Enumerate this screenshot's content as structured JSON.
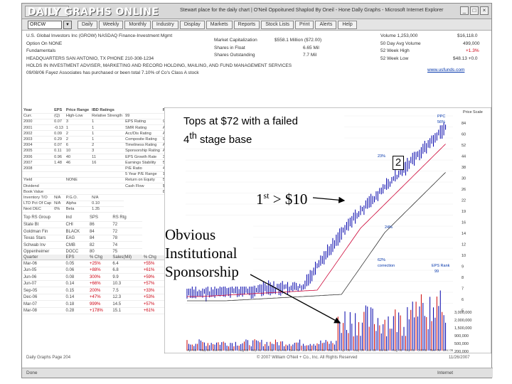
{
  "window": {
    "brand": "DAILY GRAPHS ONLINE",
    "title_bar_text": "Stewart place for the daily chart | O'Neil Oppoituned Shaplod By Oneil - Hone Dally Graphs - Microsoft Internet Explorer",
    "buttons": [
      "_",
      "□",
      "×"
    ]
  },
  "toolbar": {
    "symbol_value": "ORCW",
    "dropdown_icon": "chevron-down-icon",
    "buttons": [
      "Daily",
      "Weekly",
      "Monthly",
      "Industry",
      "Display",
      "Markets",
      "Reports",
      "Stock Lists",
      "Print",
      "Alerts",
      "Help"
    ]
  },
  "info": {
    "company_line": "U.S. Global Investors Inc (GROW) NASDAQ  Finance-Investment Mgmt",
    "option_line": "Option On   NONE",
    "fund_line": "Fundamentals",
    "hq_line": "HEADQUARTERS  SAN ANTONIO, TX        PHONE  210-308-1234",
    "desc_line_1": "HOLDS IN INVESTMENT ADVISER, MARKETING AND RECORD HOLDING, MAILING, AND FUND MANAGEMENT SERVICES",
    "desc_line_2": "09/08/06  Fayez Associates has purchased or been total 7.10% of Co's Class A stock",
    "mid_labels": [
      "Market Capitalization",
      "Shares in Float",
      "Shares Outstanding"
    ],
    "mid_values": [
      "$558.1 Million ($72.00)",
      "6.65 Mil",
      "7.7 Mil"
    ],
    "right_labels": [
      "Volume 1,253,000",
      "50 Day Avg Volume",
      "52 Week High",
      "52 Week Low"
    ],
    "right_values": [
      "$16,118.0",
      "499,000",
      "+1.3%",
      "$48.13 +0.0"
    ],
    "url_text": "www.usfunds.com"
  },
  "history": {
    "header": [
      "Year",
      "EPS",
      "Price Range",
      "IBD Ratings",
      "",
      "PERS"
    ],
    "sub_header": [
      "Curr.",
      "(Q)",
      "High-Low",
      "Relative Strength",
      "99"
    ],
    "rows": [
      [
        "2000",
        "0.07",
        "3",
        "1",
        "EPS Rating",
        "99"
      ],
      [
        "2001",
        "-0.13",
        "1",
        "1",
        "SMR Rating",
        "A"
      ],
      [
        "2002",
        "0.09",
        "2",
        "1",
        "Acc/Dis Rating",
        "A"
      ],
      [
        "2003",
        "0.29",
        "2",
        "1",
        "Composite Rating",
        "99"
      ],
      [
        "2004",
        "0.07",
        "6",
        "2",
        "Timeliness Rating",
        "A"
      ],
      [
        "2005",
        "0.11",
        "10",
        "3",
        "Sponsorship Rating",
        "A"
      ],
      [
        "2006",
        "0.96",
        "40",
        "11",
        "EPS Growth Rate",
        "35%"
      ],
      [
        "2007",
        "1.48",
        "46",
        "16",
        "Earnings Stability",
        "5"
      ],
      [
        "2008",
        "",
        "",
        "",
        "P/E Ratio",
        "41"
      ],
      [
        "",
        "",
        "",
        "",
        "5 Year P/E Range",
        "12-60"
      ],
      [
        "Yield",
        "",
        "NONE",
        "",
        "Return on Equity",
        "53%"
      ],
      [
        "Dividend",
        "",
        "",
        "",
        "Cash Flow",
        "$1.48"
      ],
      [
        "Book Value",
        "",
        "",
        "",
        "",
        "8%"
      ]
    ],
    "extra_labels": [
      "Inventory T/O",
      "LTD Pct Of Cap",
      "Next DEC"
    ],
    "extra_values": [
      "N/A",
      "N/A",
      "0%"
    ],
    "rank_labels": [
      "P.G.O.",
      "Alpha",
      "Beta"
    ],
    "rank_values": [
      "N/A",
      "0.10",
      "1.35"
    ]
  },
  "quarters": {
    "headers": [
      "Quarter",
      "EPS",
      "% Chg",
      "Sales(Mil)",
      "% Chg"
    ],
    "top_lines": [
      [
        "Top RS Group",
        "Ind",
        "SPS",
        "RS Rtg"
      ],
      [
        "State Bt",
        "CHI",
        "86",
        "72"
      ],
      [
        "Goldman Fin",
        "BLACK",
        "84",
        "72"
      ],
      [
        "Texas Stars",
        "EAG",
        "84",
        "78"
      ],
      [
        "Schwab Inv",
        "CMB",
        "82",
        "74"
      ],
      [
        "Oppenheimer",
        "DOCC",
        "80",
        "75"
      ]
    ],
    "rows": [
      [
        "Mar-06",
        "0.05",
        "+25%",
        "6.4",
        "+55%"
      ],
      [
        "Jun-05",
        "0.06",
        "+88%",
        "6.8",
        "+61%"
      ],
      [
        "Jun-06",
        "0.08",
        "300%",
        "9.9",
        "+59%"
      ],
      [
        "Jun-07",
        "0.14",
        "+66%",
        "10.3",
        "+57%"
      ],
      [
        "Sep-05",
        "0.15",
        "200%",
        "7.5",
        "+33%"
      ],
      [
        "Dec-06",
        "0.14",
        "+47%",
        "12.3",
        "+53%"
      ],
      [
        "Mar-07",
        "0.18",
        "999%",
        "14.5",
        "+57%"
      ],
      [
        "Mar-08",
        "0.28",
        "+178%",
        "15.1",
        "+61%"
      ]
    ]
  },
  "chart": {
    "price_scale_title": "Price Scale",
    "price_ticks": [
      "84",
      "60",
      "52",
      "44",
      "38",
      "30",
      "26",
      "22",
      "19",
      "16",
      "14",
      "12",
      "10",
      "9",
      "8",
      "7",
      "6",
      "5"
    ],
    "volume_ticks": [
      "3,000,000",
      "2,000,000",
      "1,500,000",
      "900,000",
      "500,000",
      "200,000"
    ],
    "month_labels": [
      "Apr 05",
      "May 05",
      "Jun 05",
      "Jul 05",
      "Aug 05",
      "Sep 05",
      "Oct 05",
      "Nov 05",
      "Dec 05",
      "Jan 06",
      "Feb 06",
      "Mar 06",
      "Apr 06",
      "May 06",
      "Jun 06",
      "Jul 06",
      "Aug 06",
      "Sep 06",
      "Oct 06",
      "Nov 06",
      "Dec 06"
    ],
    "inner_notes": [
      "PPC",
      "56%",
      "23%",
      "24%",
      "62%",
      "correction",
      "EPS Rank",
      "99"
    ],
    "accent_price": "#0000aa",
    "accent_volume": "#cc0000",
    "accent_ma": "#cc0033"
  },
  "annotations": {
    "top_note_line_1": "Tops at $72 with a failed",
    "top_note_line_2_prefix": "4",
    "top_note_line_2_sup": "th",
    "top_note_line_2_rest": " stage base",
    "sponsorship_note_1": "Obvious",
    "sponsorship_note_2": "Institutional",
    "sponsorship_note_3": "Sponsorship",
    "breakout_prefix": "1",
    "breakout_sup": "st",
    "breakout_rest": " > $10",
    "boxed_number": "2"
  },
  "footer": {
    "left": "Daily Graphs Page 204",
    "middle": "© 2007 William O'Neil + Co., Inc. All Rights Reserved",
    "right": "11/26/2007"
  },
  "status": {
    "left": "Done",
    "right": "Internet"
  }
}
